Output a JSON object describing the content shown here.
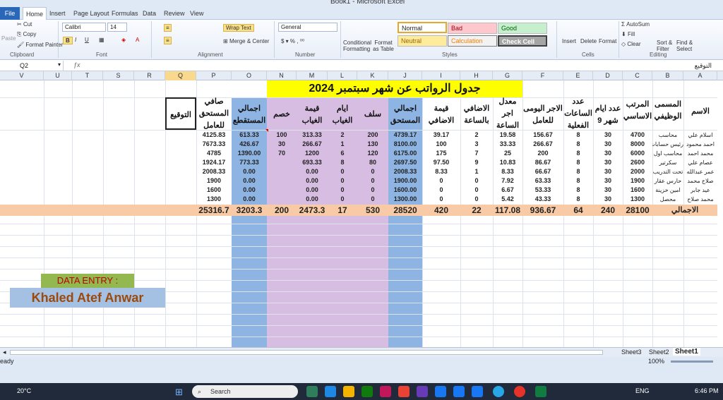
{
  "window": {
    "title": "Book1 - Microsoft Excel"
  },
  "tabs": [
    "File",
    "Home",
    "Insert",
    "Page Layout",
    "Formulas",
    "Data",
    "Review",
    "View"
  ],
  "ribbon": {
    "clipboard": {
      "cut": "Cut",
      "copy": "Copy",
      "paste": "Paste",
      "format_painter": "Format Painter",
      "label": "Clipboard"
    },
    "font": {
      "name": "Calibri",
      "size": "14",
      "label": "Font"
    },
    "alignment": {
      "wrap": "Wrap Text",
      "merge": "Merge & Center",
      "label": "Alignment"
    },
    "number": {
      "format": "General",
      "label": "Number"
    },
    "styles": {
      "conditional": "Conditional Formatting",
      "format_table": "Format as Table",
      "normal": "Normal",
      "bad": "Bad",
      "good": "Good",
      "neutral": "Neutral",
      "calculation": "Calculation",
      "check_cell": "Check Cell",
      "label": "Styles"
    },
    "cells": {
      "insert": "Insert",
      "delete": "Delete",
      "format": "Format",
      "label": "Cells"
    },
    "editing": {
      "autosum": "AutoSum",
      "fill": "Fill",
      "clear": "Clear",
      "sort": "Sort & Filter",
      "find": "Find & Select",
      "label": "Editing"
    }
  },
  "formula_bar": {
    "name_box": "Q2",
    "value": "التوقيع"
  },
  "columns": [
    "V",
    "U",
    "T",
    "S",
    "R",
    "Q",
    "P",
    "O",
    "N",
    "M",
    "L",
    "K",
    "J",
    "I",
    "H",
    "G",
    "F",
    "E",
    "D",
    "C",
    "B",
    "A"
  ],
  "sheet": {
    "title": "جدول الرواتب عن شهر سبتمبر 2024",
    "headers": {
      "A": "الاسم",
      "B": "المسمى الوظيفي",
      "C": "المرتب الاساسي",
      "D": "عدد ايام شهر 9",
      "E": "عدد الساعات الفعلية",
      "F": "الاجر اليومى للعامل",
      "G": "معدل اجر الساعة",
      "H": "الاضافي بالساعة",
      "I": "قيمة الاضافي",
      "J": "اجمالي المستحق",
      "K": "سلف",
      "L": "ايام الغياب",
      "M": "قيمة الغياب",
      "N": "خصم",
      "O": "اجمالي المستقطع",
      "P": "صافي المستحق للعامل",
      "Q": "التوقيع"
    },
    "rows": [
      {
        "A": "اسلام علي",
        "B": "محاسب",
        "C": "4700",
        "D": "30",
        "E": "8",
        "F": "156.67",
        "G": "19.58",
        "H": "2",
        "I": "39.17",
        "J": "4739.17",
        "K": "200",
        "L": "2",
        "M": "313.33",
        "N": "100",
        "O": "613.33",
        "P": "4125.83"
      },
      {
        "A": "احمد محمود",
        "B": "رئيس حسابات",
        "C": "8000",
        "D": "30",
        "E": "8",
        "F": "266.67",
        "G": "33.33",
        "H": "3",
        "I": "100",
        "J": "8100.00",
        "K": "130",
        "L": "1",
        "M": "266.67",
        "N": "30",
        "O": "426.67",
        "P": "7673.33"
      },
      {
        "A": "محمد احمد",
        "B": "محاسب اول",
        "C": "6000",
        "D": "30",
        "E": "8",
        "F": "200",
        "G": "25",
        "H": "7",
        "I": "175",
        "J": "6175.00",
        "K": "120",
        "L": "6",
        "M": "1200",
        "N": "70",
        "O": "1390.00",
        "P": "4785"
      },
      {
        "A": "عصام علي",
        "B": "سكرتير",
        "C": "2600",
        "D": "30",
        "E": "8",
        "F": "86.67",
        "G": "10.83",
        "H": "9",
        "I": "97.50",
        "J": "2697.50",
        "K": "80",
        "L": "8",
        "M": "693.33",
        "N": "",
        "O": "773.33",
        "P": "1924.17"
      },
      {
        "A": "عمر عبدالله",
        "B": "تحت التدريب",
        "C": "2000",
        "D": "30",
        "E": "8",
        "F": "66.67",
        "G": "8.33",
        "H": "1",
        "I": "8.33",
        "J": "2008.33",
        "K": "0",
        "L": "0",
        "M": "0.00",
        "N": "",
        "O": "0.00",
        "P": "2008.33"
      },
      {
        "A": "صلاح محمد",
        "B": "حارس عقار",
        "C": "1900",
        "D": "30",
        "E": "8",
        "F": "63.33",
        "G": "7.92",
        "H": "0",
        "I": "0",
        "J": "1900.00",
        "K": "0",
        "L": "0",
        "M": "0.00",
        "N": "",
        "O": "0.00",
        "P": "1900"
      },
      {
        "A": "عيد جابر",
        "B": "امين خزينة",
        "C": "1600",
        "D": "30",
        "E": "8",
        "F": "53.33",
        "G": "6.67",
        "H": "0",
        "I": "0",
        "J": "1600.00",
        "K": "0",
        "L": "0",
        "M": "0.00",
        "N": "",
        "O": "0.00",
        "P": "1600"
      },
      {
        "A": "محمد صلاح",
        "B": "محصل",
        "C": "1300",
        "D": "30",
        "E": "8",
        "F": "43.33",
        "G": "5.42",
        "H": "0",
        "I": "0",
        "J": "1300.00",
        "K": "0",
        "L": "0",
        "M": "0.00",
        "N": "",
        "O": "0.00",
        "P": "1300"
      }
    ],
    "totals": {
      "label": "الاجمالي",
      "C": "28100",
      "D": "240",
      "E": "64",
      "F": "936.67",
      "G": "117.08",
      "H": "22",
      "I": "420",
      "J": "28520",
      "K": "530",
      "L": "17",
      "M": "2473.3",
      "N": "200",
      "O": "3203.3",
      "P": "25316.7"
    },
    "data_entry_label": "DATA ENTRY :",
    "data_entry_name": "Khaled Atef Anwar"
  },
  "sheet_tabs": [
    "Sheet3",
    "Sheet2",
    "Sheet1"
  ],
  "status": {
    "left": "eady",
    "zoom": "100%"
  },
  "taskbar": {
    "weather": "20°C",
    "search": "Search",
    "lang": "ENG",
    "time": "6:46 PM"
  },
  "colors": {
    "yellow": "#ffff00",
    "blue_col": "#8eb4e3",
    "purple_col": "#d7bde2",
    "orange": "#f8cba6",
    "green_label": "#92b84f",
    "blue_label": "#a4c1e4"
  }
}
